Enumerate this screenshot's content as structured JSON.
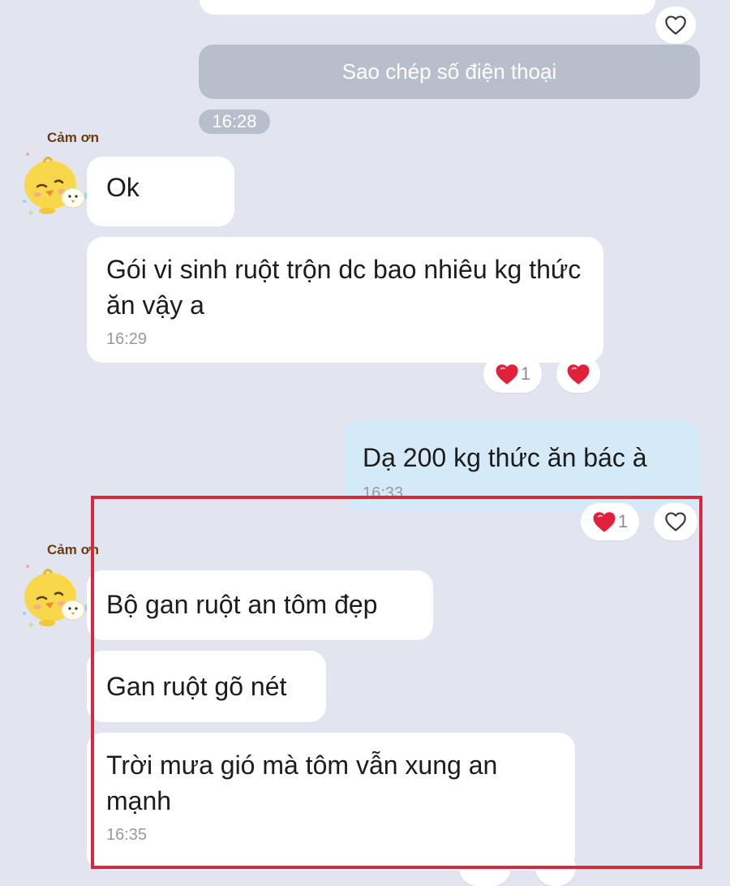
{
  "top_action": {
    "label": "Sao chép số điện thoại"
  },
  "time_badge": "16:28",
  "sticker_label": "Cảm ơn",
  "messages": [
    {
      "text": "Ok"
    },
    {
      "text": "Gói vi sinh ruột trộn dc bao nhiêu kg thức ăn vậy a",
      "time": "16:29",
      "reaction_count": "1"
    },
    {
      "text": "Dạ 200 kg thức ăn bác à",
      "time": "16:33",
      "reaction_count": "1"
    },
    {
      "text": "Bộ gan ruột an tôm đẹp"
    },
    {
      "text": "Gan ruột gõ nét"
    },
    {
      "text": "Trời mưa gió mà tôm vẫn xung an mạnh",
      "time": "16:35"
    }
  ],
  "colors": {
    "background": "#e2e5ef",
    "incoming_bubble": "#ffffff",
    "outgoing_bubble": "#d5eaf9",
    "highlight_box": "#d8283e",
    "heart": "#e3203b"
  },
  "icons": [
    "heart-outline-icon",
    "heart-filled-icon",
    "chick-sticker-avatar"
  ]
}
